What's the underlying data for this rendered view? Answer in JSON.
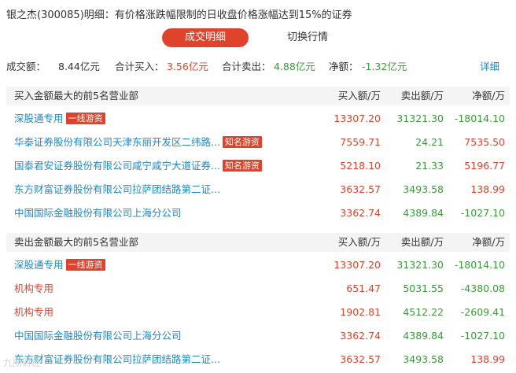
{
  "title": "银之杰(300085)明细：有价格涨跌幅限制的日收盘价格涨幅达到15%的证券",
  "tabs": {
    "active": "成交明细",
    "inactive": "切换行情"
  },
  "summary": {
    "turnover_label": "成交额：",
    "turnover_value": "8.44亿元",
    "buy_label": "合计买入：",
    "buy_value": "3.56亿元",
    "sell_label": "合计卖出：",
    "sell_value": "4.88亿元",
    "net_label": "净额：",
    "net_value": "-1.32亿元",
    "detail_link": "详细"
  },
  "buy_section": {
    "header": "买入金额最大的前5名营业部",
    "col_buy": "买入额/万",
    "col_sell": "卖出额/万",
    "col_net": "净额/万",
    "rows": [
      {
        "name": "深股通专用",
        "badge": "一线游资",
        "buy": "13307.20",
        "sell": "31321.30",
        "net": "-18014.10"
      },
      {
        "name": "华泰证券股份有限公司天津东丽开发区二纬路...",
        "badge": "知名游资",
        "buy": "7559.71",
        "sell": "24.21",
        "net": "7535.50"
      },
      {
        "name": "国泰君安证券股份有限公司咸宁咸宁大道证券...",
        "badge": "知名游资",
        "buy": "5218.10",
        "sell": "21.33",
        "net": "5196.77"
      },
      {
        "name": "东方财富证券股份有限公司拉萨团结路第二证...",
        "badge": "",
        "buy": "3632.57",
        "sell": "3493.58",
        "net": "138.99"
      },
      {
        "name": "中国国际金融股份有限公司上海分公司",
        "badge": "",
        "buy": "3362.74",
        "sell": "4389.84",
        "net": "-1027.10"
      }
    ]
  },
  "sell_section": {
    "header": "卖出金额最大的前5名营业部",
    "col_buy": "买入额/万",
    "col_sell": "卖出额/万",
    "col_net": "净额/万",
    "rows": [
      {
        "name": "深股通专用",
        "badge": "一线游资",
        "buy": "13307.20",
        "sell": "31321.30",
        "net": "-18014.10"
      },
      {
        "name": "机构专用",
        "badge": "",
        "buy": "651.47",
        "sell": "5031.55",
        "net": "-4380.08"
      },
      {
        "name": "机构专用",
        "badge": "",
        "buy": "1902.81",
        "sell": "4512.22",
        "net": "-2609.41"
      },
      {
        "name": "中国国际金融股份有限公司上海分公司",
        "badge": "",
        "buy": "3362.74",
        "sell": "4389.84",
        "net": "-1027.10"
      },
      {
        "name": "东方财富证券股份有限公司拉萨团结路第二证...",
        "badge": "",
        "buy": "3632.57",
        "sell": "3493.58",
        "net": "138.99"
      }
    ]
  },
  "watermark": "九丽财经",
  "colors": {
    "red": "#e0432b",
    "green": "#3a9a3a",
    "link": "#1e88c8"
  }
}
